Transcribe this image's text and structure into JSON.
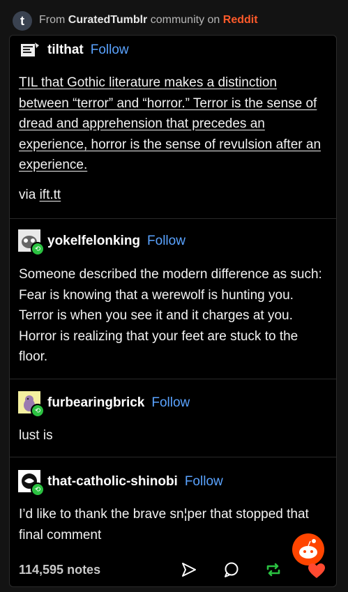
{
  "header": {
    "logo_letter": "t",
    "prefix": "From",
    "community": "CuratedTumblr",
    "middle": "community on",
    "platform": "Reddit"
  },
  "posts": [
    {
      "username": "tilthat",
      "follow": "Follow",
      "text": "TIL that Gothic literature makes a distinction between “terror” and “horror.” Terror is the sense of dread and apprehension that precedes an experience, horror is the sense of revulsion after an experience.",
      "via_label": "via",
      "via_link": "ift.tt"
    },
    {
      "username": "yokelfelonking",
      "follow": "Follow",
      "text": "Someone described the modern difference as such:  Fear is knowing that a werewolf is hunting you.  Terror is when you see it and it charges at you.  Horror is realizing that your feet are stuck to the floor."
    },
    {
      "username": "furbearingbrick",
      "follow": "Follow",
      "text": "lust is"
    },
    {
      "username": "that-catholic-shinobi",
      "follow": "Follow",
      "text": "I’d like to thank the brave sn¦per that stopped that final comment"
    }
  ],
  "footer": {
    "notes": "114,595 notes",
    "icons": [
      "share-icon",
      "comment-icon",
      "reblog-icon",
      "like-icon"
    ]
  },
  "colors": {
    "follow": "#5aa3ff",
    "reblog": "#2bc241",
    "like": "#ff4930",
    "reddit": "#ff5a2a"
  }
}
